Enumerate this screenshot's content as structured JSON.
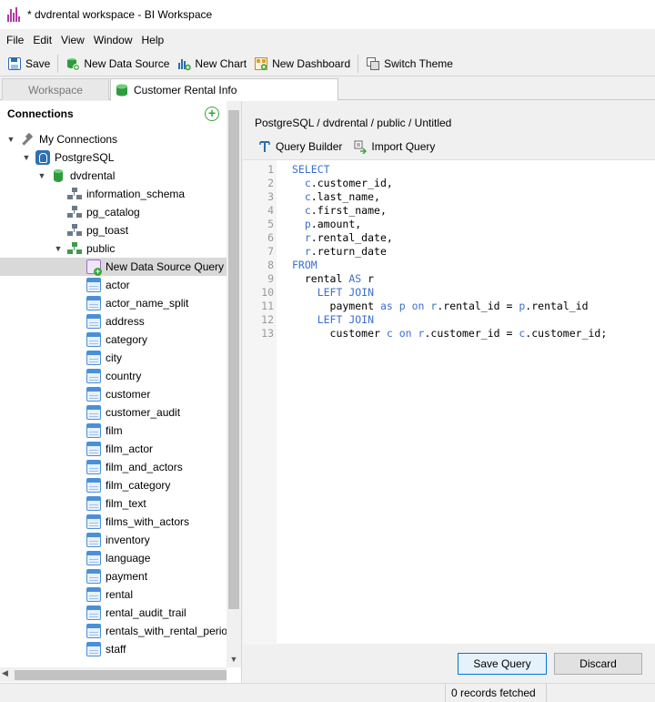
{
  "window": {
    "title": "* dvdrental workspace - BI Workspace"
  },
  "menu": [
    "File",
    "Edit",
    "View",
    "Window",
    "Help"
  ],
  "toolbar": {
    "save": "Save",
    "new_data_source": "New Data Source",
    "new_chart": "New Chart",
    "new_dashboard": "New Dashboard",
    "switch_theme": "Switch Theme"
  },
  "tabs": {
    "workspace": "Workspace",
    "active": "Customer Rental Info"
  },
  "connections": {
    "header": "Connections",
    "tree": {
      "root": "My Connections",
      "server": "PostgreSQL",
      "database": "dvdrental",
      "schemas": [
        "information_schema",
        "pg_catalog",
        "pg_toast",
        "public"
      ],
      "selected_item": "New Data Source Query",
      "tables": [
        "actor",
        "actor_name_split",
        "address",
        "category",
        "city",
        "country",
        "customer",
        "customer_audit",
        "film",
        "film_actor",
        "film_and_actors",
        "film_category",
        "film_text",
        "films_with_actors",
        "inventory",
        "language",
        "payment",
        "rental",
        "rental_audit_trail",
        "rentals_with_rental_perio",
        "staff"
      ]
    }
  },
  "editor": {
    "breadcrumb": "PostgreSQL / dvdrental / public / Untitled",
    "query_builder": "Query Builder",
    "import_query": "Import Query",
    "line_numbers": [
      "1",
      "2",
      "3",
      "4",
      "5",
      "6",
      "7",
      "8",
      "9",
      "10",
      "11",
      "12",
      "13"
    ],
    "code_lines": [
      "SELECT",
      "  c.customer_id,",
      "  c.last_name,",
      "  c.first_name,",
      "  p.amount,",
      "  r.rental_date,",
      "  r.return_date",
      "FROM",
      "  rental AS r",
      "    LEFT JOIN",
      "      payment as p on r.rental_id = p.rental_id",
      "    LEFT JOIN",
      "      customer c on r.customer_id = c.customer_id;"
    ]
  },
  "buttons": {
    "save_query": "Save Query",
    "discard": "Discard"
  },
  "status": {
    "records": "0 records fetched"
  },
  "colors": {
    "keyword": "#3a6fcf",
    "selection": "#d9d9d9",
    "primary_border": "#0078d7"
  }
}
